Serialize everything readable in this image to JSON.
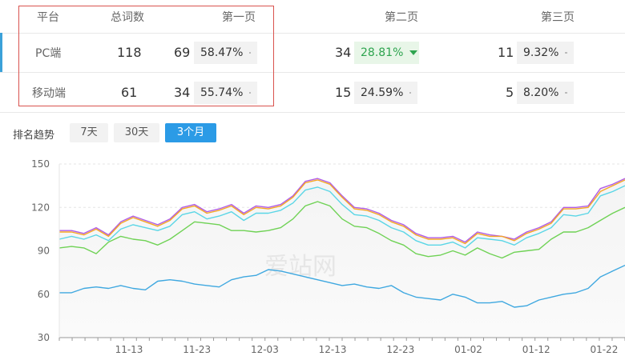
{
  "table": {
    "headers": {
      "platform": "平台",
      "total": "总词数",
      "page1": "第一页",
      "page2": "第二页",
      "page3": "第三页"
    },
    "rows": [
      {
        "platform": "PC端",
        "total": "118",
        "p1_count": "69",
        "p1_pct": "58.47%",
        "p1_trend": "flat",
        "p2_count": "34",
        "p2_pct": "28.81%",
        "p2_trend": "down",
        "p3_count": "11",
        "p3_pct": "9.32%",
        "p3_trend": "flat"
      },
      {
        "platform": "移动端",
        "total": "61",
        "p1_count": "34",
        "p1_pct": "55.74%",
        "p1_trend": "flat",
        "p2_count": "15",
        "p2_pct": "24.59%",
        "p2_trend": "flat",
        "p3_count": "5",
        "p3_pct": "8.20%",
        "p3_trend": "flat"
      }
    ]
  },
  "trend": {
    "label": "排名趋势",
    "ranges": [
      "7天",
      "30天",
      "3个月"
    ],
    "active_range": "3个月"
  },
  "colors": {
    "accent": "#3ba1d9",
    "active_button": "#2b9be6",
    "highlight_box": "#d9534f",
    "trend_down": "#2ea44f"
  },
  "chart_data": {
    "type": "line",
    "watermark": "爱站网",
    "ylim": [
      30,
      150
    ],
    "yticks": [
      30,
      60,
      90,
      120,
      150
    ],
    "xticks": [
      "11-13",
      "11-23",
      "12-03",
      "12-13",
      "12-23",
      "01-02",
      "01-12",
      "01-22"
    ],
    "grid": true,
    "series": [
      {
        "color": "#b05ce6",
        "values": [
          104,
          104,
          102,
          106,
          101,
          110,
          114,
          111,
          108,
          112,
          120,
          122,
          117,
          119,
          122,
          116,
          121,
          120,
          122,
          128,
          138,
          140,
          137,
          128,
          120,
          119,
          116,
          111,
          108,
          102,
          99,
          99,
          100,
          96,
          103,
          101,
          100,
          98,
          103,
          106,
          110,
          120,
          120,
          121,
          133,
          136,
          140
        ]
      },
      {
        "color": "#f5a623",
        "values": [
          103,
          103,
          101,
          105,
          100,
          109,
          113,
          110,
          107,
          111,
          119,
          121,
          116,
          118,
          121,
          115,
          120,
          119,
          121,
          127,
          137,
          139,
          136,
          127,
          119,
          118,
          115,
          110,
          107,
          101,
          98,
          98,
          99,
          95,
          102,
          100,
          100,
          97,
          102,
          105,
          109,
          119,
          119,
          120,
          131,
          135,
          139
        ]
      },
      {
        "color": "#5ad6e6",
        "values": [
          98,
          100,
          98,
          101,
          97,
          105,
          108,
          106,
          104,
          107,
          115,
          117,
          112,
          114,
          117,
          111,
          116,
          116,
          118,
          123,
          132,
          134,
          131,
          122,
          115,
          114,
          111,
          106,
          103,
          97,
          94,
          94,
          96,
          92,
          99,
          98,
          97,
          94,
          99,
          102,
          106,
          115,
          114,
          116,
          128,
          131,
          135
        ]
      },
      {
        "color": "#6fd255",
        "values": [
          92,
          93,
          92,
          88,
          96,
          100,
          98,
          97,
          94,
          98,
          104,
          110,
          109,
          108,
          104,
          104,
          103,
          104,
          106,
          112,
          121,
          124,
          121,
          112,
          107,
          106,
          102,
          97,
          94,
          88,
          86,
          87,
          90,
          87,
          92,
          88,
          85,
          89,
          90,
          91,
          98,
          103,
          103,
          106,
          111,
          116,
          120
        ]
      },
      {
        "color": "#3fa8e0",
        "values": [
          61,
          61,
          64,
          65,
          64,
          66,
          64,
          63,
          69,
          70,
          69,
          67,
          66,
          65,
          70,
          72,
          73,
          77,
          76,
          74,
          72,
          70,
          68,
          66,
          67,
          65,
          64,
          66,
          61,
          58,
          57,
          56,
          60,
          58,
          54,
          54,
          55,
          51,
          52,
          56,
          58,
          60,
          61,
          64,
          72,
          76,
          80
        ]
      }
    ]
  }
}
